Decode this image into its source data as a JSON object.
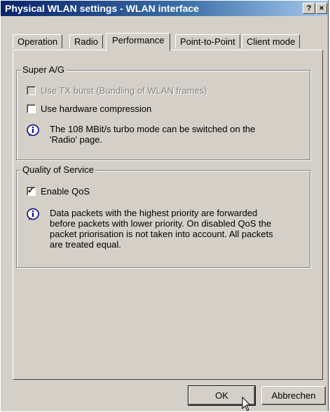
{
  "window": {
    "title": "Physical WLAN settings - WLAN interface",
    "help_button": "?",
    "close_button": "×"
  },
  "tabs": [
    {
      "label": "Operation",
      "active": false
    },
    {
      "label": "Radio",
      "active": false
    },
    {
      "label": "Performance",
      "active": true
    },
    {
      "label": "Point-to-Point",
      "active": false
    },
    {
      "label": "Client mode",
      "active": false
    }
  ],
  "super_ag": {
    "title": "Super A/G",
    "tx_burst_label": "Use TX burst (Bundling of WLAN frames)",
    "tx_burst_checked": false,
    "tx_burst_enabled": false,
    "hw_compression_label": "Use hardware compression",
    "hw_compression_checked": false,
    "info_line1": "The 108 MBit/s turbo mode can be switched on the",
    "info_line2": "'Radio' page."
  },
  "qos": {
    "title": "Quality of Service",
    "enable_label": "Enable QoS",
    "enable_checked": true,
    "info_line1": "Data packets with the highest priority are forwarded",
    "info_line2": "before packets with lower priority. On disabled QoS the",
    "info_line3": "packet priorisation is not taken into account. All packets",
    "info_line4": "are treated equal."
  },
  "buttons": {
    "ok_label": "OK",
    "cancel_label": "Abbrechen"
  },
  "icon_names": [
    "info-icon",
    "help-icon",
    "close-icon",
    "mouse-cursor-icon"
  ]
}
